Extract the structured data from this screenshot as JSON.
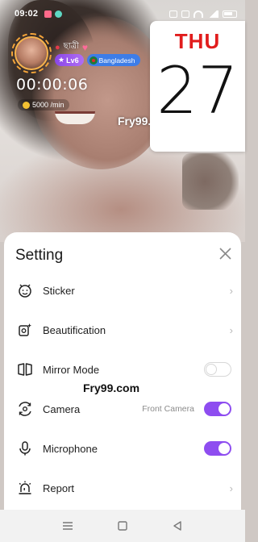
{
  "status_bar": {
    "time": "09:02"
  },
  "host": {
    "name": "ছাত্রী",
    "level": "Lv6",
    "country": "Bangladesh",
    "call_timer": "00:00:06",
    "rate": "5000 /min"
  },
  "watermark": "Fry99.com",
  "calendar": {
    "day": "THU",
    "date": "27"
  },
  "settings": {
    "title": "Setting",
    "items": [
      {
        "label": "Sticker",
        "icon": "sticker-icon",
        "control": "chevron"
      },
      {
        "label": "Beautification",
        "icon": "beautify-icon",
        "control": "chevron"
      },
      {
        "label": "Mirror Mode",
        "icon": "mirror-icon",
        "control": "toggle",
        "enabled": false
      },
      {
        "label": "Camera",
        "icon": "camera-icon",
        "control": "toggle",
        "value": "Front Camera",
        "enabled": true
      },
      {
        "label": "Microphone",
        "icon": "microphone-icon",
        "control": "toggle",
        "enabled": true
      },
      {
        "label": "Report",
        "icon": "report-icon",
        "control": "chevron"
      }
    ]
  },
  "colors": {
    "accent": "#8e4df0",
    "calendar_day": "#e11d1d"
  }
}
